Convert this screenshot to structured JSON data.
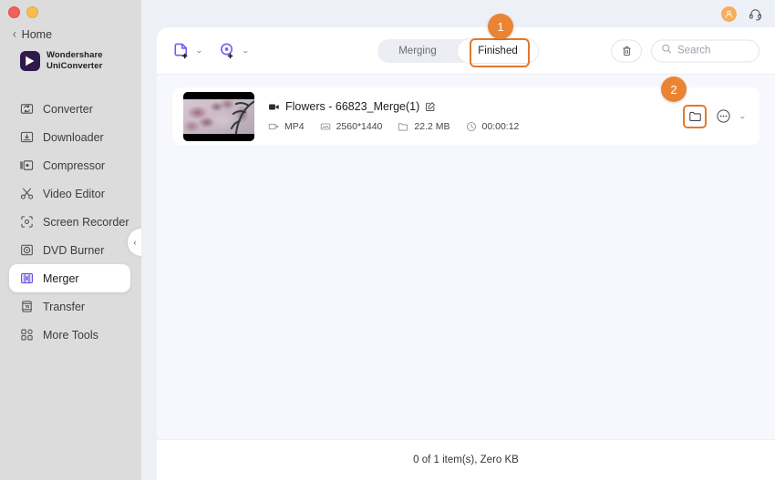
{
  "window": {
    "traffic_lights": [
      "close",
      "minimize"
    ]
  },
  "sidebar": {
    "home_label": "Home",
    "brand": {
      "line1": "Wondershare",
      "line2": "UniConverter"
    },
    "items": [
      {
        "label": "Converter",
        "icon": "converter-icon",
        "active": false
      },
      {
        "label": "Downloader",
        "icon": "downloader-icon",
        "active": false
      },
      {
        "label": "Compressor",
        "icon": "compressor-icon",
        "active": false
      },
      {
        "label": "Video Editor",
        "icon": "video-editor-icon",
        "active": false
      },
      {
        "label": "Screen Recorder",
        "icon": "screen-recorder-icon",
        "active": false
      },
      {
        "label": "DVD Burner",
        "icon": "dvd-burner-icon",
        "active": false
      },
      {
        "label": "Merger",
        "icon": "merger-icon",
        "active": true
      },
      {
        "label": "Transfer",
        "icon": "transfer-icon",
        "active": false
      },
      {
        "label": "More Tools",
        "icon": "more-tools-icon",
        "active": false
      }
    ],
    "collapse_glyph": "‹"
  },
  "titlebar": {
    "avatar_icon": "user-avatar-icon",
    "support_icon": "headset-icon"
  },
  "toolbar": {
    "add_file_icon": "add-file-icon",
    "add_file_caret": "⌄",
    "add_record_icon": "add-record-icon",
    "add_record_caret": "⌄",
    "tabs": [
      {
        "label": "Merging",
        "active": false
      },
      {
        "label": "Finished",
        "active": true
      }
    ],
    "trash_icon": "trash-icon",
    "search": {
      "icon": "search-icon",
      "placeholder": "Search",
      "value": ""
    }
  },
  "callouts": [
    {
      "number": "1",
      "target": "finished-tab"
    },
    {
      "number": "2",
      "target": "open-folder-button"
    }
  ],
  "file_list": {
    "items": [
      {
        "name": "Flowers - 66823_Merge(1)",
        "video_icon": "video-camera-icon",
        "edit_icon": "edit-pencil-icon",
        "format_icon": "format-icon",
        "format": "MP4",
        "resolution_icon": "resolution-icon",
        "resolution": "2560*1440",
        "size_icon": "folder-size-icon",
        "size": "22.2 MB",
        "duration_icon": "clock-icon",
        "duration": "00:00:12",
        "thumbnail_alt": "cherry-blossom-video-thumbnail",
        "open_folder_icon": "folder-icon",
        "more_icon": "more-options-icon",
        "more_caret": "⌄"
      }
    ]
  },
  "footer": {
    "status": "0 of 1 item(s), Zero KB"
  },
  "colors": {
    "accent_purple": "#7a5af0",
    "callout_orange": "#ea8432",
    "highlight_border": "#e2792c",
    "avatar_orange": "#f6ae5c",
    "sidebar_bg": "#dcdcdc",
    "panel_bg": "#ffffff",
    "list_bg": "#f7f8fd"
  }
}
